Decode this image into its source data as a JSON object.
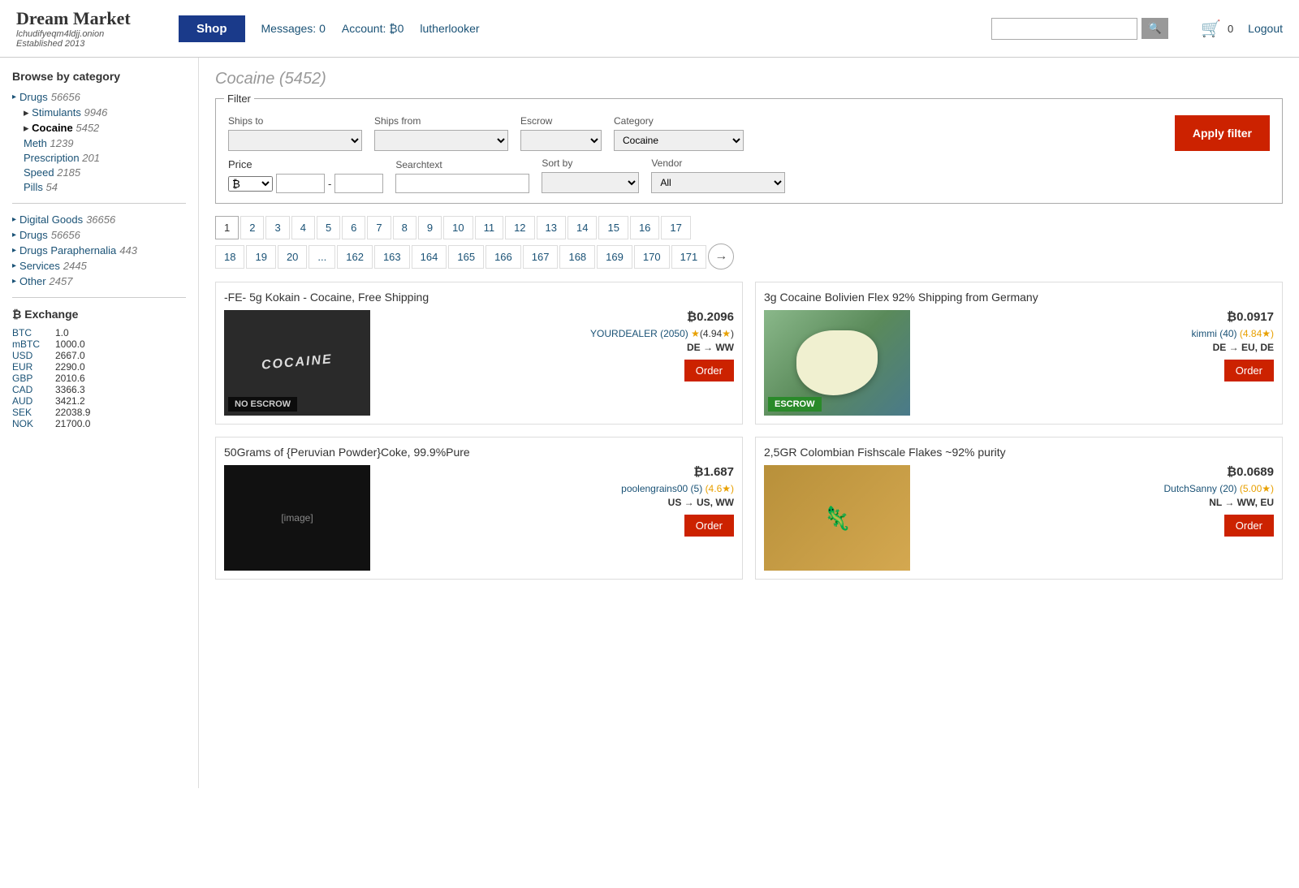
{
  "site": {
    "name": "Dream Market",
    "url": "lchudifyeqm4ldjj.onion",
    "established": "Established 2013"
  },
  "header": {
    "shop_label": "Shop",
    "messages_label": "Messages: 0",
    "account_label": "Account: ₿0",
    "username": "lutherlooker",
    "search_placeholder": "",
    "cart_count": "0",
    "logout_label": "Logout"
  },
  "sidebar": {
    "browse_title": "Browse by category",
    "categories": [
      {
        "name": "Drugs",
        "count": "56656",
        "active": false
      },
      {
        "name": "Stimulants",
        "count": "9946",
        "active": false,
        "sub": true
      },
      {
        "name": "Cocaine",
        "count": "5452",
        "active": true,
        "sub": true,
        "bold": true
      },
      {
        "name": "Meth",
        "count": "1239",
        "active": false,
        "sub": true
      },
      {
        "name": "Prescription",
        "count": "201",
        "active": false,
        "sub": true
      },
      {
        "name": "Speed",
        "count": "2185",
        "active": false,
        "sub": true
      },
      {
        "name": "Pills",
        "count": "54",
        "active": false,
        "sub": true
      }
    ],
    "top_categories": [
      {
        "name": "Digital Goods",
        "count": "36656"
      },
      {
        "name": "Drugs",
        "count": "56656"
      },
      {
        "name": "Drugs Paraphernalia",
        "count": "443"
      },
      {
        "name": "Services",
        "count": "2445"
      },
      {
        "name": "Other",
        "count": "2457"
      }
    ],
    "exchange_title": "₿ Exchange",
    "exchange_rates": [
      {
        "currency": "BTC",
        "rate": "1.0"
      },
      {
        "currency": "mBTC",
        "rate": "1000.0"
      },
      {
        "currency": "USD",
        "rate": "2667.0"
      },
      {
        "currency": "EUR",
        "rate": "2290.0"
      },
      {
        "currency": "GBP",
        "rate": "2010.6"
      },
      {
        "currency": "CAD",
        "rate": "3366.3"
      },
      {
        "currency": "AUD",
        "rate": "3421.2"
      },
      {
        "currency": "SEK",
        "rate": "22038.9"
      },
      {
        "currency": "NOK",
        "rate": "21700.0"
      }
    ]
  },
  "page_title": "Cocaine (5452)",
  "filter": {
    "legend": "Filter",
    "ships_to_label": "Ships to",
    "ships_from_label": "Ships from",
    "escrow_label": "Escrow",
    "category_label": "Category",
    "category_value": "Cocaine",
    "price_label": "Price",
    "price_currency": "₿",
    "searchtext_label": "Searchtext",
    "sortby_label": "Sort by",
    "vendor_label": "Vendor",
    "vendor_value": "All",
    "apply_label": "Apply filter"
  },
  "pagination": {
    "pages": [
      "1",
      "2",
      "3",
      "4",
      "5",
      "6",
      "7",
      "8",
      "9",
      "10",
      "11",
      "12",
      "13",
      "14",
      "15",
      "16",
      "17",
      "18",
      "19",
      "20",
      "...",
      "162",
      "163",
      "164",
      "165",
      "166",
      "167",
      "168",
      "169",
      "170",
      "171"
    ],
    "current": "1"
  },
  "products": [
    {
      "title": "-FE- 5g Kokain - Cocaine, Free Shipping",
      "price": "₿0.2096",
      "vendor": "YOURDEALER (2050)",
      "rating": "4.94★",
      "shipping": "DE → WW",
      "escrow": "NO ESCROW",
      "escrow_type": "no-escrow",
      "image_text": "COCAINE",
      "image_bg": "#2a2a2a"
    },
    {
      "title": "3g Cocaine Bolivien Flex 92% Shipping from Germany",
      "price": "₿0.0917",
      "vendor": "kimmi (40)",
      "rating": "4.84★",
      "shipping": "DE → EU, DE",
      "escrow": "ESCROW",
      "escrow_type": "escrow",
      "image_text": "",
      "image_bg": "#b0c4b0"
    },
    {
      "title": "50Grams of {Peruvian Powder}Coke, 99.9%Pure",
      "price": "₿1.687",
      "vendor": "poolengrains00 (5)",
      "rating": "4.6★",
      "shipping": "US → US, WW",
      "escrow": "",
      "escrow_type": "",
      "image_text": "",
      "image_bg": "#1a1a1a"
    },
    {
      "title": "2,5GR Colombian Fishscale Flakes ~92% purity",
      "price": "₿0.0689",
      "vendor": "DutchSanny (20)",
      "rating": "5.00★",
      "shipping": "NL → WW, EU",
      "escrow": "",
      "escrow_type": "",
      "image_text": "",
      "image_bg": "#c8a060"
    }
  ]
}
